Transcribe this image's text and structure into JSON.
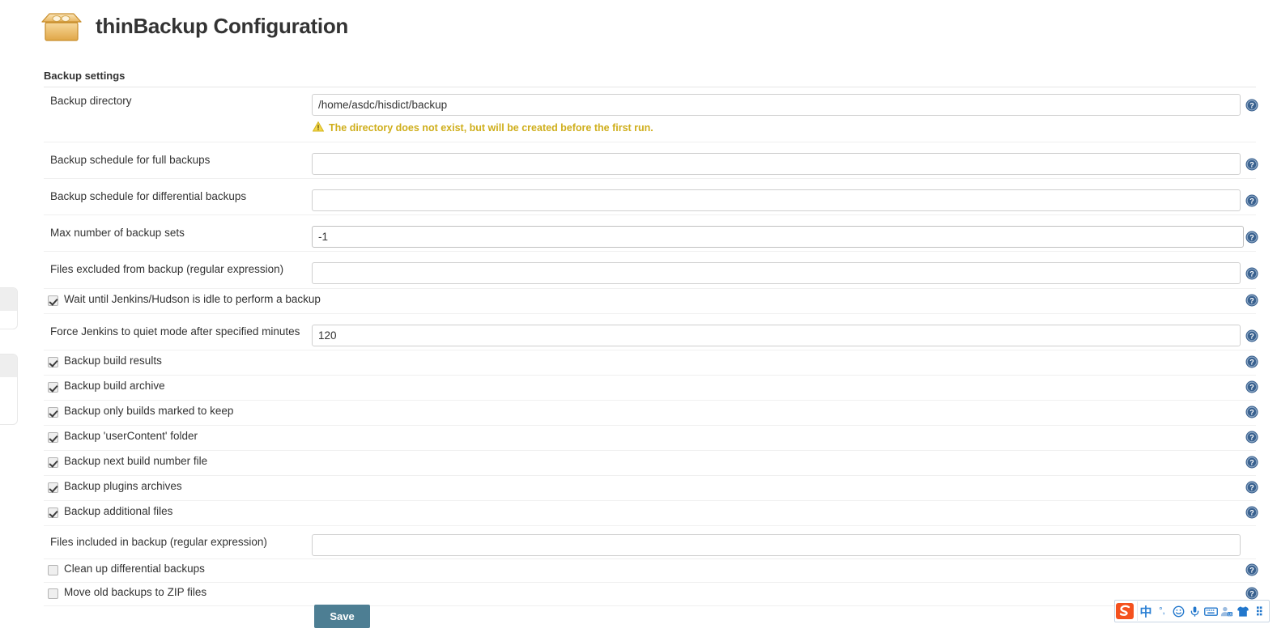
{
  "header": {
    "title": "thinBackup Configuration",
    "icon": "backup-box-icon"
  },
  "section": {
    "title": "Backup settings"
  },
  "fields": [
    {
      "id": "backup-directory",
      "label": "Backup directory",
      "value": "/home/asdc/hisdict/backup",
      "placeholder": "",
      "help": "help-icon"
    },
    {
      "id": "full-backup-schedule",
      "label": "Backup schedule for full backups",
      "value": "",
      "placeholder": "",
      "help": "help-icon"
    },
    {
      "id": "differential-backup-schedule",
      "label": "Backup schedule for differential backups",
      "value": "",
      "placeholder": "",
      "help": "help-icon"
    },
    {
      "id": "max-backup-sets",
      "label": "Max number of backup sets",
      "value": "-1",
      "placeholder": "",
      "help": "help-icon"
    },
    {
      "id": "excluded-files",
      "label": "Files excluded from backup (regular expression)",
      "value": "",
      "placeholder": "",
      "help": "help-icon"
    },
    {
      "id": "quiet-mode-minutes",
      "label": "Force Jenkins to quiet mode after specified minutes",
      "value": "120",
      "placeholder": "",
      "help": "help-icon"
    },
    {
      "id": "included-files",
      "label": "Files included in backup (regular expression)",
      "value": "",
      "placeholder": "",
      "help": "help-icon"
    }
  ],
  "warning": {
    "icon": "warning-triangle-icon",
    "text": "The directory does not exist, but will be created before the first run.",
    "color": "#cfae1b"
  },
  "checkboxes": [
    {
      "id": "wait-until-idle",
      "label": "Wait until Jenkins/Hudson is idle to perform a backup",
      "checked": true
    },
    {
      "id": "backup-build-results",
      "label": "Backup build results",
      "checked": true
    },
    {
      "id": "backup-build-archive",
      "label": "Backup build archive",
      "checked": true
    },
    {
      "id": "backup-marked-to-keep",
      "label": "Backup only builds marked to keep",
      "checked": true
    },
    {
      "id": "backup-usercontent",
      "label": "Backup 'userContent' folder",
      "checked": true
    },
    {
      "id": "backup-next-build-num",
      "label": "Backup next build number file",
      "checked": true
    },
    {
      "id": "backup-plugins",
      "label": "Backup plugins archives",
      "checked": true
    },
    {
      "id": "backup-additional-files",
      "label": "Backup additional files",
      "checked": true
    },
    {
      "id": "cleanup-differential",
      "label": "Clean up differential backups",
      "checked": false
    },
    {
      "id": "move-to-zip",
      "label": "Move old backups to ZIP files",
      "checked": false
    }
  ],
  "buttons": {
    "save_label": "Save"
  },
  "ime_toolbar": {
    "logo": "sogou-logo-icon",
    "items": [
      {
        "id": "language-mode",
        "glyph": "中",
        "name": "chinese-mode-icon"
      },
      {
        "id": "punctuation",
        "glyph": "°,",
        "name": "punctuation-mode-icon"
      },
      {
        "id": "emoji",
        "glyph": "☺",
        "name": "emoji-icon"
      },
      {
        "id": "voice-input",
        "glyph": "🎤",
        "name": "microphone-icon"
      },
      {
        "id": "soft-keyboard",
        "glyph": "⌨",
        "name": "keyboard-icon"
      },
      {
        "id": "user-center",
        "glyph": "👤",
        "name": "user-icon"
      },
      {
        "id": "skin",
        "glyph": "👕",
        "name": "skin-icon"
      },
      {
        "id": "toolbox",
        "glyph": "⋮",
        "name": "toolbox-icon"
      }
    ]
  },
  "colors": {
    "accent": "#4d7e93",
    "warning": "#cfae1b",
    "help_icon": "#39618f",
    "text": "#333333"
  }
}
